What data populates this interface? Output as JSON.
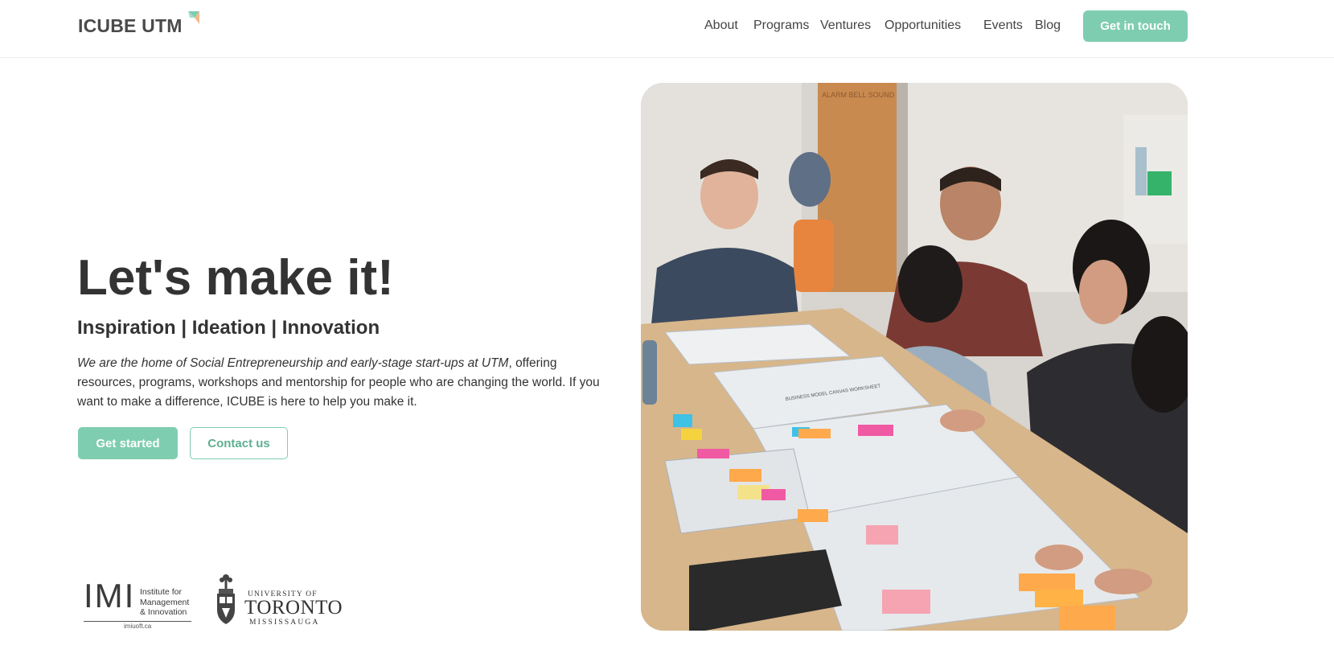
{
  "header": {
    "brand": "ICUBE UTM",
    "brand_colors": [
      "#7fcdb0",
      "#f2b98a"
    ],
    "nav": [
      {
        "label": "About"
      },
      {
        "label": "Programs"
      },
      {
        "label": "Ventures"
      },
      {
        "label": "Opportunities"
      },
      {
        "label": "Events"
      },
      {
        "label": "Blog"
      }
    ],
    "cta_label": "Get in touch"
  },
  "hero": {
    "title": "Let's make it!",
    "subtitle": "Inspiration | Ideation | Innovation",
    "description_italic": "We are the home of Social Entrepreneurship and early-stage start-ups at UTM",
    "description_rest": ", offering resources, programs, workshops and mentorship for people who are changing the world. If you want to make a difference, ICUBE is here to help you make it.",
    "primary_button": "Get started",
    "secondary_button": "Contact us"
  },
  "partners": {
    "imi": {
      "acronym": "IMI",
      "line1": "Institute for",
      "line2": "Management",
      "line3": "& Innovation",
      "url": "imiuoft.ca"
    },
    "uoft": {
      "top": "UNIVERSITY OF",
      "name": "TORONTO",
      "campus": "MISSISSAUGA"
    }
  },
  "photo": {
    "subject": "workshop-participants-photo",
    "sign_text": "ALARM BELL SOUND",
    "worksheet_text": "BUSINESS MODEL CANVAS WORKSHEET"
  },
  "theme": {
    "accent": "#7fcdb0",
    "text": "#333333"
  }
}
